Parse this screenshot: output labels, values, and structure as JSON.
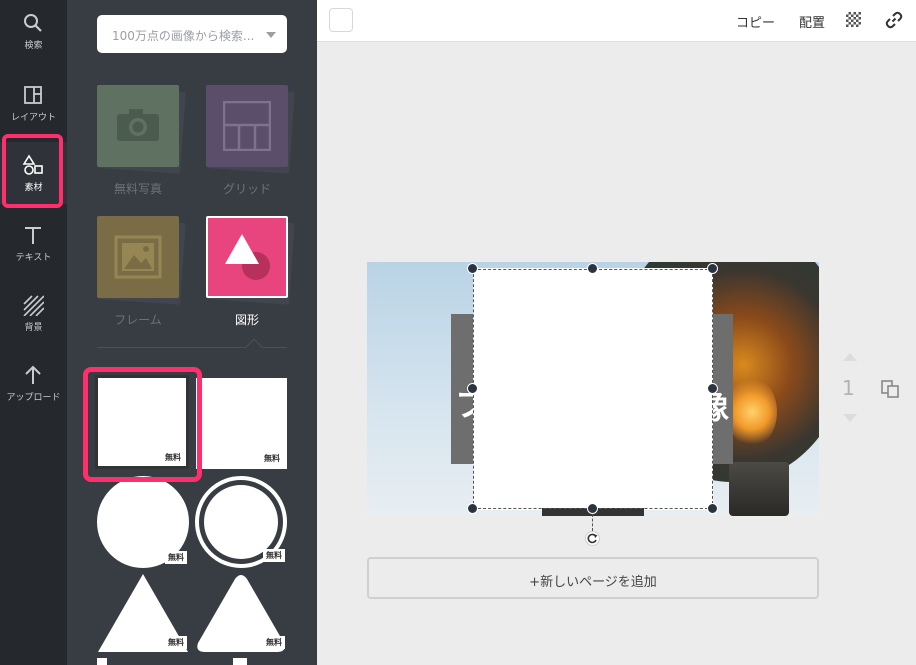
{
  "sidebar": {
    "items": [
      {
        "label": "検索",
        "icon": "search-icon"
      },
      {
        "label": "レイアウト",
        "icon": "layout-icon"
      },
      {
        "label": "素材",
        "icon": "elements-icon",
        "active": true
      },
      {
        "label": "テキスト",
        "icon": "text-icon"
      },
      {
        "label": "背景",
        "icon": "background-icon"
      },
      {
        "label": "アップロード",
        "icon": "upload-icon"
      }
    ]
  },
  "panel": {
    "search_placeholder": "100万点の画像から検索...",
    "categories": [
      {
        "label": "無料写真",
        "icon": "camera-icon"
      },
      {
        "label": "グリッド",
        "icon": "grid-icon"
      },
      {
        "label": "フレーム",
        "icon": "frame-icon"
      },
      {
        "label": "図形",
        "icon": "shapes-icon",
        "active": true
      }
    ],
    "shapes": [
      {
        "kind": "square",
        "badge": "無料"
      },
      {
        "kind": "square",
        "badge": "無料"
      },
      {
        "kind": "circle",
        "badge": "無料"
      },
      {
        "kind": "ring",
        "badge": "無料"
      },
      {
        "kind": "triangle",
        "badge": "無料"
      },
      {
        "kind": "rounded-triangle",
        "badge": "無料"
      }
    ]
  },
  "toolbar": {
    "copy_label": "コピー",
    "arrange_label": "配置",
    "transparency_icon": "checkerboard-icon",
    "link_icon": "link-icon"
  },
  "canvas": {
    "text_left": "フ",
    "text_right": "像",
    "page_number": "1",
    "add_page_label": "+新しいページを追加"
  },
  "colors": {
    "accent": "#ff2e6c",
    "rail_bg": "#25282d",
    "panel_bg": "#383c43",
    "shapes_tile": "#e8447e"
  }
}
